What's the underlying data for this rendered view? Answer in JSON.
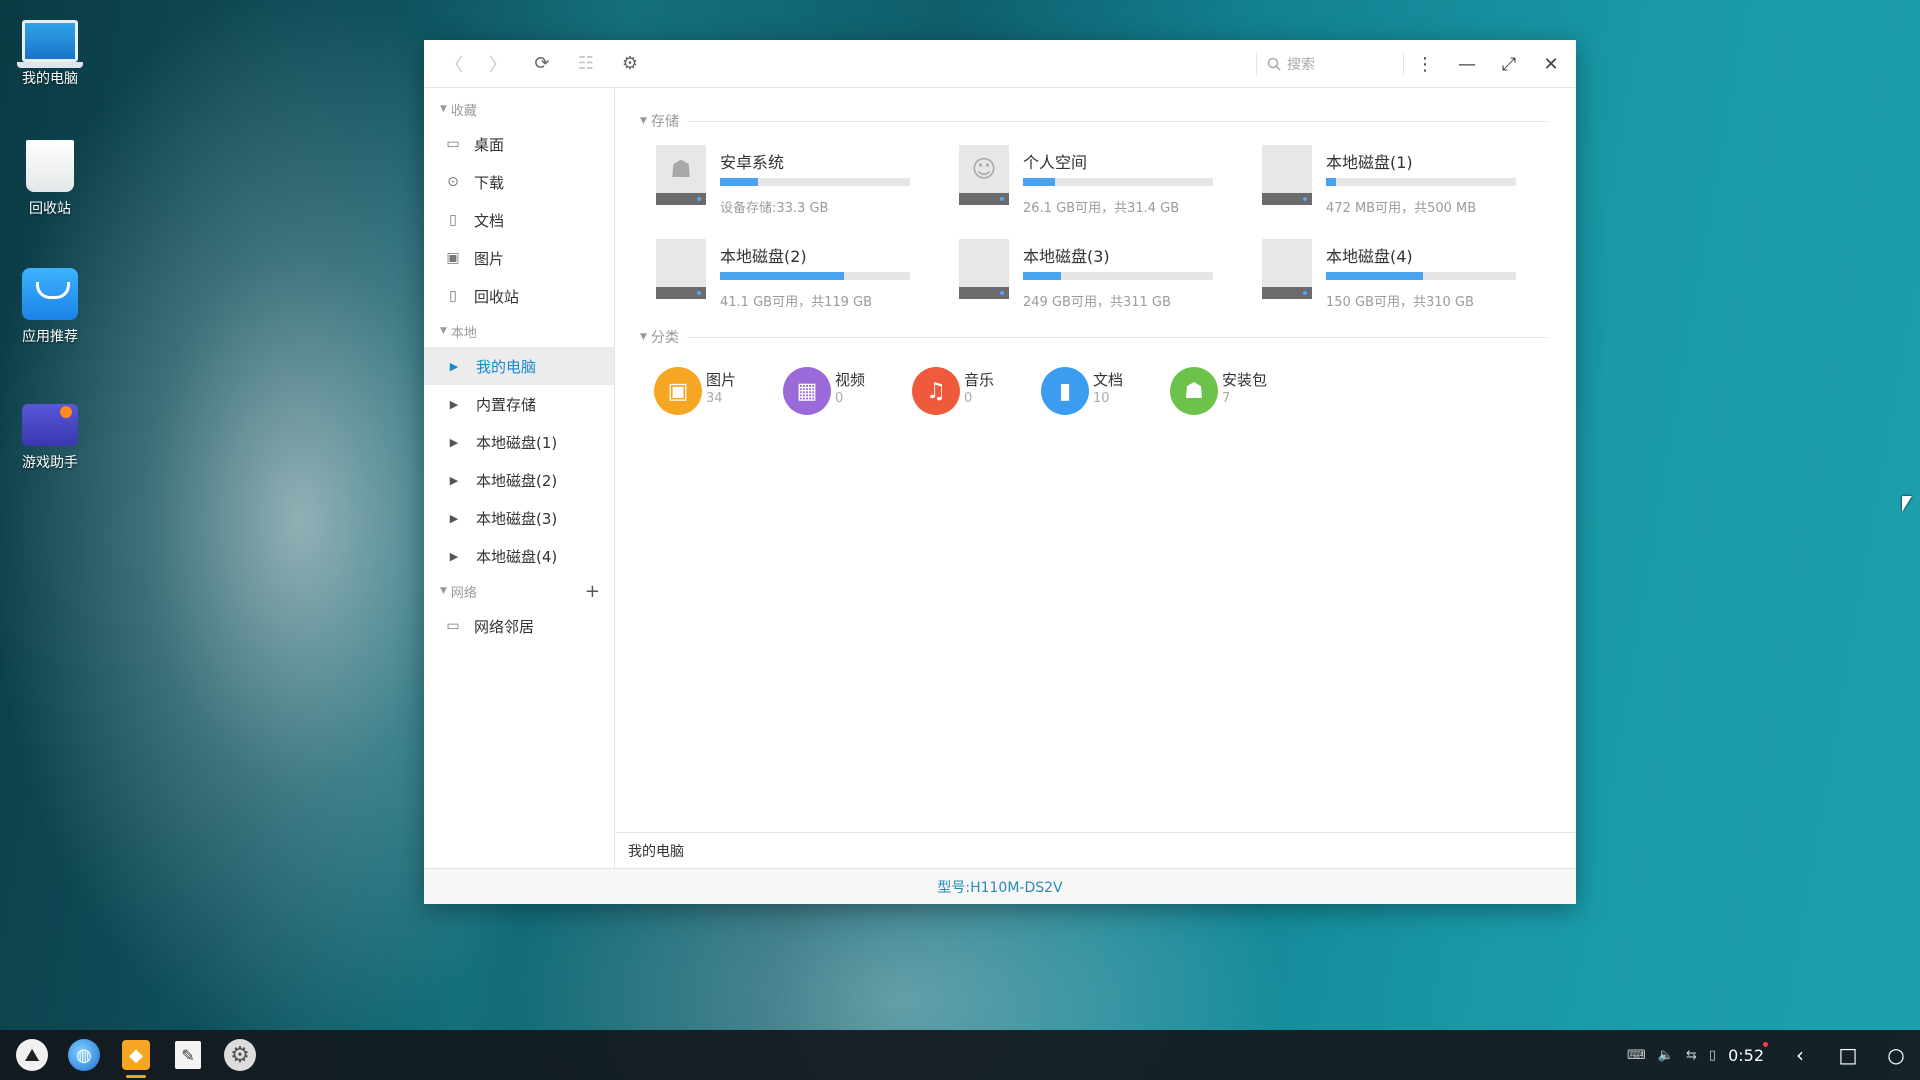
{
  "desktop": {
    "icons": [
      {
        "label": "我的电脑",
        "icon": "computer-icon"
      },
      {
        "label": "回收站",
        "icon": "trash-icon"
      },
      {
        "label": "应用推荐",
        "icon": "app-store-icon"
      },
      {
        "label": "游戏助手",
        "icon": "game-keyboard-icon"
      }
    ]
  },
  "window": {
    "toolbar": {
      "back": "〈",
      "forward": "〉",
      "refresh": "⟳",
      "view": "☷",
      "settings": "⚙",
      "search_placeholder": "搜索",
      "more": "⋮",
      "minimize": "—",
      "maximize": "⤢",
      "close": "✕"
    },
    "sidebar": {
      "favorites_header": "收藏",
      "favorites": [
        {
          "label": "桌面",
          "icon": "desktop-icon"
        },
        {
          "label": "下载",
          "icon": "download-icon"
        },
        {
          "label": "文档",
          "icon": "document-icon"
        },
        {
          "label": "图片",
          "icon": "image-icon"
        },
        {
          "label": "回收站",
          "icon": "trash-icon"
        }
      ],
      "local_header": "本地",
      "local": [
        {
          "label": "我的电脑",
          "active": true
        },
        {
          "label": "内置存储"
        },
        {
          "label": "本地磁盘(1)"
        },
        {
          "label": "本地磁盘(2)"
        },
        {
          "label": "本地磁盘(3)"
        },
        {
          "label": "本地磁盘(4)"
        }
      ],
      "network_header": "网络",
      "network_add": "+",
      "network": [
        {
          "label": "网络邻居",
          "icon": "network-icon"
        }
      ]
    },
    "storage_header": "存储",
    "disks": [
      {
        "name": "安卓系统",
        "detail": "设备存储:33.3 GB",
        "usage": 0.2,
        "icon": "android-icon"
      },
      {
        "name": "个人空间",
        "detail": "26.1 GB可用，共31.4 GB",
        "usage": 0.17,
        "icon": "person-icon"
      },
      {
        "name": "本地磁盘(1)",
        "detail": "472 MB可用，共500 MB",
        "usage": 0.05,
        "icon": "disk-icon"
      },
      {
        "name": "本地磁盘(2)",
        "detail": "41.1 GB可用，共119 GB",
        "usage": 0.65,
        "icon": "disk-icon"
      },
      {
        "name": "本地磁盘(3)",
        "detail": "249 GB可用，共311 GB",
        "usage": 0.2,
        "icon": "disk-icon"
      },
      {
        "name": "本地磁盘(4)",
        "detail": "150 GB可用，共310 GB",
        "usage": 0.51,
        "icon": "disk-icon"
      }
    ],
    "category_header": "分类",
    "categories": [
      {
        "name": "图片",
        "count": "34",
        "color": "#f6a623",
        "icon": "image-icon"
      },
      {
        "name": "视频",
        "count": "0",
        "color": "#9b6ad9",
        "icon": "video-icon"
      },
      {
        "name": "音乐",
        "count": "0",
        "color": "#f05a3c",
        "icon": "music-icon"
      },
      {
        "name": "文档",
        "count": "10",
        "color": "#3b9cf0",
        "icon": "document-icon"
      },
      {
        "name": "安装包",
        "count": "7",
        "color": "#6cc24a",
        "icon": "android-icon"
      }
    ],
    "path": "我的电脑",
    "status": "型号:H110M-DS2V"
  },
  "taskbar": {
    "apps": [
      {
        "name": "launcher",
        "icon": "launcher-icon"
      },
      {
        "name": "browser",
        "icon": "globe-icon"
      },
      {
        "name": "file-manager",
        "icon": "folder-icon",
        "running": true
      },
      {
        "name": "editor",
        "icon": "pen-icon"
      },
      {
        "name": "settings",
        "icon": "gear-icon"
      }
    ],
    "clock": "0:52"
  }
}
